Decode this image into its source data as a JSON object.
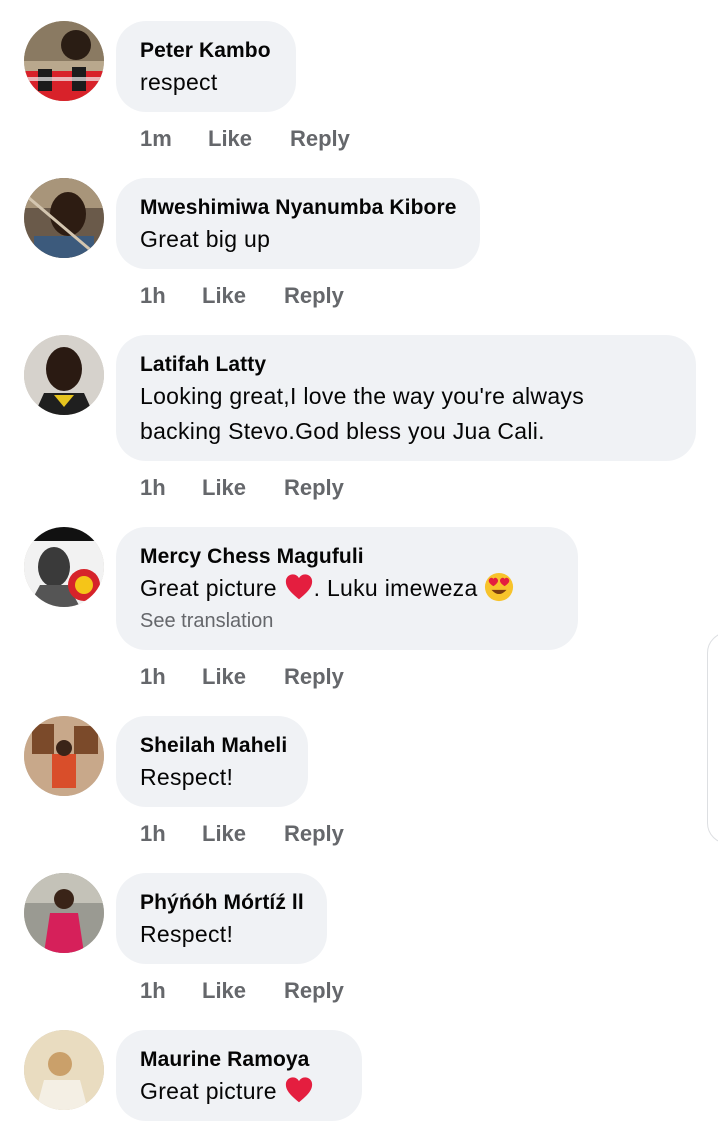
{
  "comments": [
    {
      "name": "Peter Kambo",
      "lines": [
        "respect"
      ],
      "time": "1m",
      "like": "Like",
      "reply": "Reply",
      "avatar": "avatar-peter"
    },
    {
      "name": "Mweshimiwa Nyanumba Kibore",
      "lines": [
        "Great big up"
      ],
      "time": "1h",
      "like": "Like",
      "reply": "Reply",
      "avatar": "avatar-mweshimiwa"
    },
    {
      "name": "Latifah Latty",
      "lines": [
        "Looking great,I love the way you're always",
        "backing Stevo.God bless you Jua Cali."
      ],
      "time": "1h",
      "like": "Like",
      "reply": "Reply",
      "avatar": "avatar-latifah"
    },
    {
      "name": "Mercy Chess Magufuli",
      "text_before": "Great picture",
      "text_after": ". Luku imeweza",
      "see_translation": "See translation",
      "time": "1h",
      "like": "Like",
      "reply": "Reply",
      "avatar": "avatar-mercy"
    },
    {
      "name": "Sheilah Maheli",
      "lines": [
        "Respect!"
      ],
      "time": "1h",
      "like": "Like",
      "reply": "Reply",
      "avatar": "avatar-sheilah"
    },
    {
      "name": "Phýńóh Mórtíź ll",
      "lines": [
        "Respect!"
      ],
      "time": "1h",
      "like": "Like",
      "reply": "Reply",
      "avatar": "avatar-phynoh"
    },
    {
      "name": "Maurine Ramoya",
      "text_before": "Great picture",
      "avatar": "avatar-maurine"
    }
  ],
  "colors": {
    "bubble": "#f0f2f5",
    "secondary_text": "#65676b",
    "heart": "#e41e3f"
  },
  "icons": {
    "heart": "red-heart-icon",
    "heart_eyes": "heart-eyes-emoji-icon"
  }
}
